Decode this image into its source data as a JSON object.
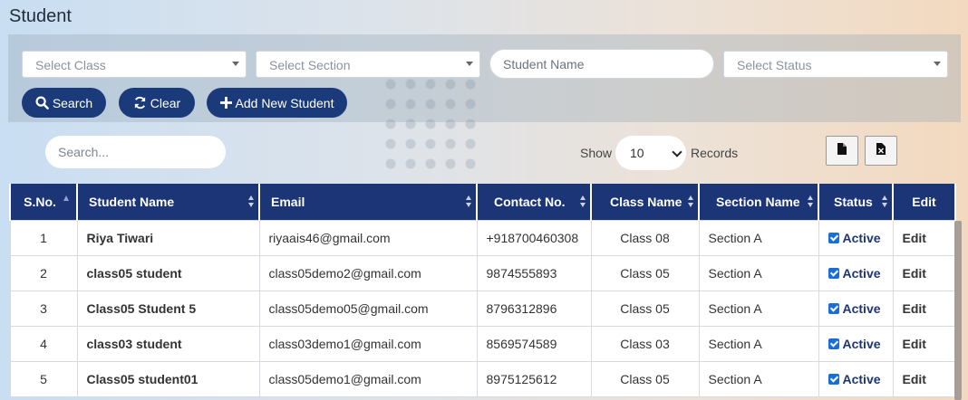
{
  "page": {
    "title": "Student"
  },
  "filters": {
    "class_placeholder": "Select Class",
    "section_placeholder": "Select Section",
    "name_placeholder": "Student Name",
    "status_placeholder": "Select Status"
  },
  "actions": {
    "search_label": "Search",
    "clear_label": "Clear",
    "add_label": "Add New Student"
  },
  "table_controls": {
    "search_placeholder": "Search...",
    "show_label": "Show",
    "page_size": "10",
    "records_label": "Records"
  },
  "table": {
    "headers": [
      "S.No.",
      "Student Name",
      "Email",
      "Contact No.",
      "Class Name",
      "Section Name",
      "Status",
      "Edit"
    ],
    "rows": [
      {
        "sno": "1",
        "name": "Riya Tiwari",
        "email": "riyaais46@gmail.com",
        "contact": "+918700460308",
        "class": "Class 08",
        "section": "Section A",
        "status": "Active",
        "edit": "Edit"
      },
      {
        "sno": "2",
        "name": "class05 student",
        "email": "class05demo2@gmail.com",
        "contact": "9874555893",
        "class": "Class 05",
        "section": "Section A",
        "status": "Active",
        "edit": "Edit"
      },
      {
        "sno": "3",
        "name": "Class05 Student 5",
        "email": "class05demo05@gmail.com",
        "contact": "8796312896",
        "class": "Class 05",
        "section": "Section A",
        "status": "Active",
        "edit": "Edit"
      },
      {
        "sno": "4",
        "name": "class03 student",
        "email": "class03demo1@gmail.com",
        "contact": "8569574589",
        "class": "Class 03",
        "section": "Section A",
        "status": "Active",
        "edit": "Edit"
      },
      {
        "sno": "5",
        "name": "Class05 student01",
        "email": "class05demo1@gmail.com",
        "contact": "8975125612",
        "class": "Class 05",
        "section": "Section A",
        "status": "Active",
        "edit": "Edit"
      }
    ]
  },
  "icons": {
    "search": "search-icon",
    "clear": "refresh-icon",
    "add": "plus-icon",
    "export_file": "file-icon",
    "export_excel": "excel-icon"
  },
  "colors": {
    "primary": "#1b3577",
    "checkbox": "#1a6fd6"
  }
}
